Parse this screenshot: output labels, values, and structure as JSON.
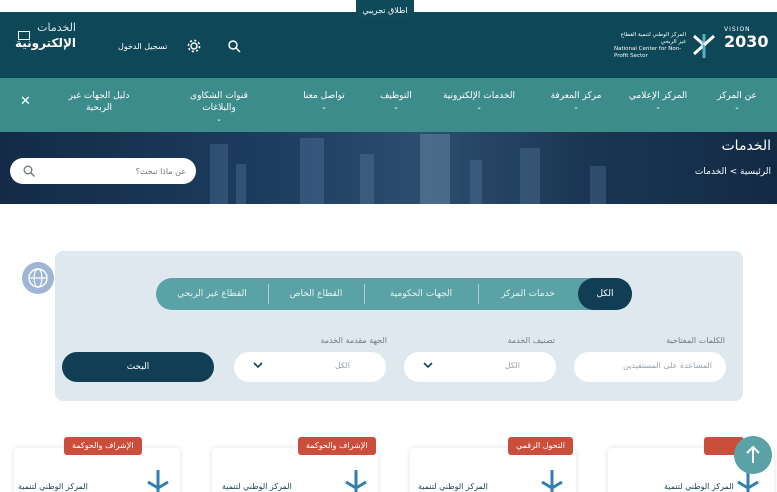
{
  "header": {
    "launch_label": "اطلاق تجريبي",
    "eservices_line1": "الخدمات",
    "eservices_line2": "الإلكترونية",
    "login_label": "تسجيل الدخول",
    "vision_small": "VISION",
    "vision_year": "2030",
    "center_name_ar": "المركز الوطني لتنمية القطاع غير الربحي",
    "center_name_en": "National Center for Non-Profit Sector"
  },
  "nav": {
    "items": [
      {
        "label": "عن المركز",
        "has_menu": true
      },
      {
        "label": "المركز الإعلامي",
        "has_menu": true
      },
      {
        "label": "مركز المعرفة",
        "has_menu": true
      },
      {
        "label": "الخدمات الإلكترونية",
        "has_menu": true
      },
      {
        "label": "التوظيف",
        "has_menu": true
      },
      {
        "label": "تواصل معنا",
        "has_menu": true
      },
      {
        "label": "قنوات الشكاوى والبلاغات",
        "has_menu": true
      },
      {
        "label": "دليل الجهات غير الربحية",
        "has_menu": false
      }
    ]
  },
  "hero": {
    "title": "الخدمات",
    "breadcrumb": "الرئيسية > الخدمات",
    "search_placeholder": "عن ماذا تبحث؟"
  },
  "filters": {
    "tabs": [
      "الكل",
      "خدمات المركز",
      "الجهات الحكومية",
      "القطاع الخاص",
      "القطاع غير الربحي"
    ],
    "active_tab": 0,
    "keywords_label": "الكلمات المفتاحية",
    "keywords_placeholder": "المساعدة على المستفيدين",
    "category_label": "تصنيف الخدمة",
    "category_value": "الكل",
    "provider_label": "الجهة مقدمة الخدمة",
    "provider_value": "الكل",
    "search_button": "البحث"
  },
  "cards": [
    {
      "tag": "الإشراف والحوكمة",
      "title": "المركز الوطني لتنمية"
    },
    {
      "tag": "الإشراف والحوكمة",
      "title": "المركز الوطني لتنمية"
    },
    {
      "tag": "التحول الرقمي",
      "title": "المركز الوطني لتنمية"
    },
    {
      "tag": "",
      "title": "المركز الوطني لتنمية"
    }
  ],
  "colors": {
    "header_bg": "#0e4757",
    "nav_bg": "#3d8c8c",
    "accent_dark": "#123e55",
    "tag_red": "#c94f3c"
  }
}
